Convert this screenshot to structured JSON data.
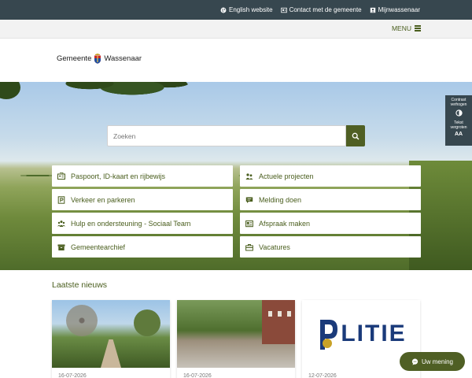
{
  "topbar": {
    "links": [
      {
        "label": "English website",
        "icon": "globe-icon"
      },
      {
        "label": "Contact met de gemeente",
        "icon": "contact-icon"
      },
      {
        "label": "Mijnwassenaar",
        "icon": "account-icon"
      }
    ],
    "color": "#37474f"
  },
  "menu": {
    "label": "MENU",
    "icon": "hamburger-icon"
  },
  "logo": {
    "left": "Gemeente",
    "right": "Wassenaar"
  },
  "search": {
    "placeholder": "Zoeken",
    "button_icon": "search-icon"
  },
  "tiles": [
    {
      "label": "Paspoort, ID-kaart en rijbewijs",
      "icon": "id-card-icon"
    },
    {
      "label": "Actuele projecten",
      "icon": "people-icon"
    },
    {
      "label": "Verkeer en parkeren",
      "icon": "parking-icon"
    },
    {
      "label": "Melding doen",
      "icon": "message-icon"
    },
    {
      "label": "Hulp en ondersteuning - Sociaal Team",
      "icon": "group-icon"
    },
    {
      "label": "Afspraak maken",
      "icon": "appointment-icon"
    },
    {
      "label": "Gemeentearchief",
      "icon": "archive-icon"
    },
    {
      "label": "Vacatures",
      "icon": "briefcase-icon"
    }
  ],
  "accessibility": {
    "contrast_label": "Contrast verhogen",
    "text_label": "Tekst vergroten",
    "text_glyph": "AA"
  },
  "news": {
    "title": "Laatste nieuws",
    "cards": [
      {
        "date": "16-07-2026",
        "image": "garden-photo"
      },
      {
        "date": "16-07-2026",
        "image": "street-photo"
      },
      {
        "date": "12-07-2026",
        "image": "politie-logo",
        "logo_text": "LITIE"
      }
    ]
  },
  "chat": {
    "label": "Uw mening",
    "icon": "chat-icon"
  },
  "colors": {
    "accent": "#4f5f24",
    "text_green": "#4a5e1e",
    "dark": "#37474f"
  }
}
